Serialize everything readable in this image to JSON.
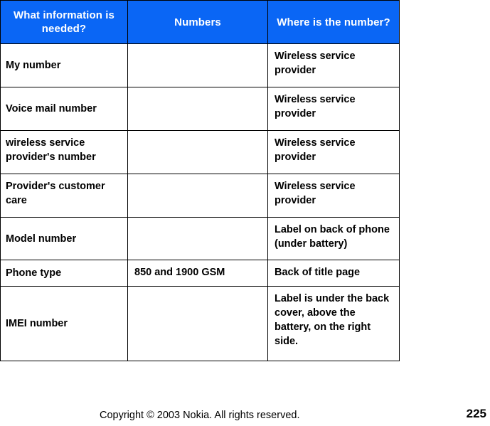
{
  "table": {
    "headers": [
      "What information is needed?",
      "Numbers",
      "Where is the number?"
    ],
    "header_bg_color": "#0a66f5",
    "header_text_color": "#ffffff",
    "border_color": "#000000",
    "rows": [
      {
        "info": "My number",
        "number": "",
        "where": "Wireless service provider"
      },
      {
        "info": "Voice mail number",
        "number": "",
        "where": "Wireless service provider"
      },
      {
        "info": "wireless service provider's number",
        "number": "",
        "where": "Wireless service provider"
      },
      {
        "info": "Provider's customer care",
        "number": "",
        "where": "Wireless service provider"
      },
      {
        "info": "Model number",
        "number": "",
        "where": "Label on back of phone (under battery)"
      },
      {
        "info": "Phone type",
        "number": "850 and 1900 GSM",
        "where": "Back of title page"
      },
      {
        "info": "IMEI number",
        "number": "",
        "where": "Label is under the back cover, above the battery, on the right side."
      }
    ]
  },
  "footer": {
    "copyright": "Copyright © 2003 Nokia. All rights reserved.",
    "page_number": "225"
  }
}
